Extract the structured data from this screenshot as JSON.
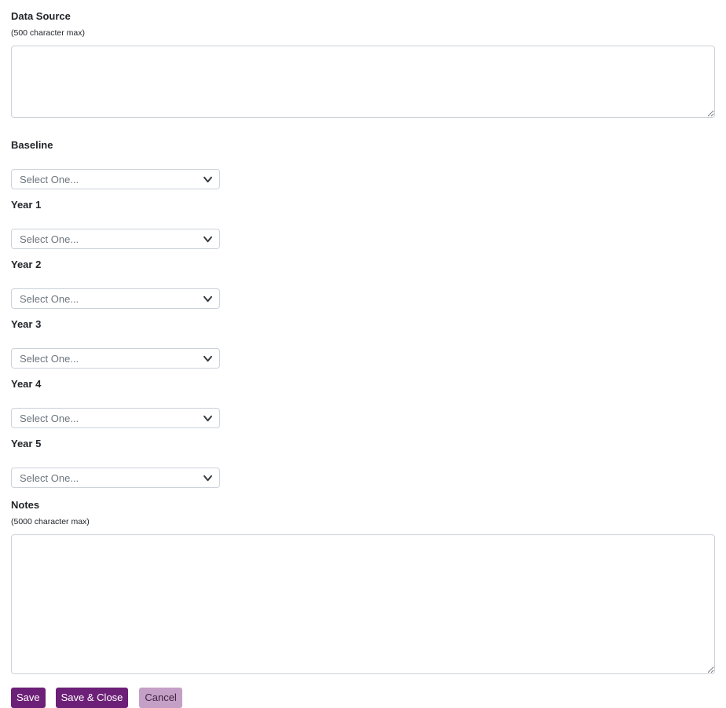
{
  "data_source": {
    "label": "Data Source",
    "hint": "(500 character max)",
    "value": ""
  },
  "selects": [
    {
      "label": "Baseline",
      "value": "Select One..."
    },
    {
      "label": "Year 1",
      "value": "Select One..."
    },
    {
      "label": "Year 2",
      "value": "Select One..."
    },
    {
      "label": "Year 3",
      "value": "Select One..."
    },
    {
      "label": "Year 4",
      "value": "Select One..."
    },
    {
      "label": "Year 5",
      "value": "Select One..."
    }
  ],
  "notes": {
    "label": "Notes",
    "hint": "(5000 character max)",
    "value": ""
  },
  "buttons": {
    "save": "Save",
    "save_close": "Save & Close",
    "cancel": "Cancel"
  },
  "colors": {
    "primary_button_bg": "#6d2077",
    "primary_button_text": "#ffffff",
    "cancel_button_bg": "#c49fc6",
    "cancel_button_text": "#3f2442",
    "input_border": "#ccd2da",
    "select_placeholder_text": "#6c757d",
    "label_text": "#212529"
  }
}
